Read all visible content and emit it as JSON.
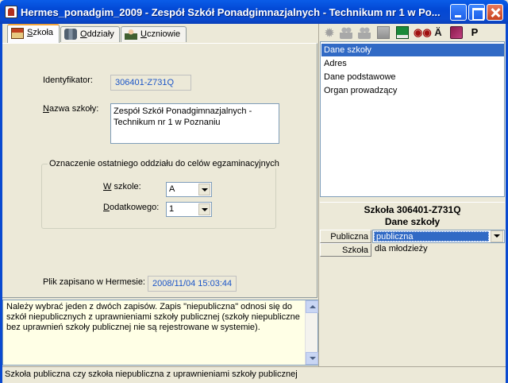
{
  "window": {
    "title": "Hermes_ponadgim_2009 - Zespół Szkół Ponadgimnazjalnych - Technikum nr 1 w Po..."
  },
  "tabs": [
    {
      "pre": "",
      "u": "S",
      "post": "zkoła"
    },
    {
      "pre": "",
      "u": "O",
      "post": "ddziały"
    },
    {
      "pre": "",
      "u": "U",
      "post": "czniowie"
    }
  ],
  "form": {
    "identifier_label": "Identyfikator:",
    "identifier_value": "306401-Z731Q",
    "name_label_u": "N",
    "name_label_rest": "azwa szkoły:",
    "name_value": "Zespół Szkół Ponadgimnazjalnych - Technikum nr 1 w Poznaniu",
    "group_title": "Oznaczenie ostatniego oddziału do celów egzaminacyjnych",
    "in_school_label_u": "W",
    "in_school_label_rest": " szkole:",
    "in_school_value": "A",
    "additional_label_u": "D",
    "additional_label_rest": "odatkowego:",
    "additional_value": "1",
    "saved_label": "Plik zapisano w Hermesie:",
    "saved_value": "2008/11/04 15:03:44"
  },
  "help_text": "Należy wybrać jeden z dwóch zapisów. Zapis \"niepubliczna\" odnosi się do szkół niepublicznych z uprawnieniami szkoły publicznej (szkoły niepubliczne bez uprawnień szkoły publicznej nie są rejestrowane w systemie).",
  "status_text": "Szkoła publiczna czy szkoła niepubliczna z uprawnieniami szkoły publicznej",
  "toolbar": {
    "icons": [
      "gear-icon",
      "add-people-icon",
      "remove-people-icon",
      "copy-icon",
      "save-icon",
      "binoculars-icon",
      "letter-a-icon",
      "book-icon",
      "letter-p-icon"
    ],
    "find_glyph": "ĝĝ",
    "a_glyph": "Ä",
    "p_glyph": "P"
  },
  "right_list": {
    "items": [
      "Dane szkoły",
      "Adres",
      "Dane podstawowe",
      "Organ prowadzący"
    ],
    "selected_index": 0
  },
  "properties": {
    "header_line1": "Szkoła 306401-Z731Q",
    "header_line2": "Dane szkoły",
    "rows": [
      {
        "key": "Publiczna",
        "value": "publiczna"
      },
      {
        "key": "Szkoła",
        "value": "dla młodzieży"
      }
    ]
  },
  "colors": {
    "title_bar": "#0a4ad0",
    "selection": "#316ac5",
    "help_bg": "#ffffe6",
    "readonly_text": "#1c56c8"
  }
}
